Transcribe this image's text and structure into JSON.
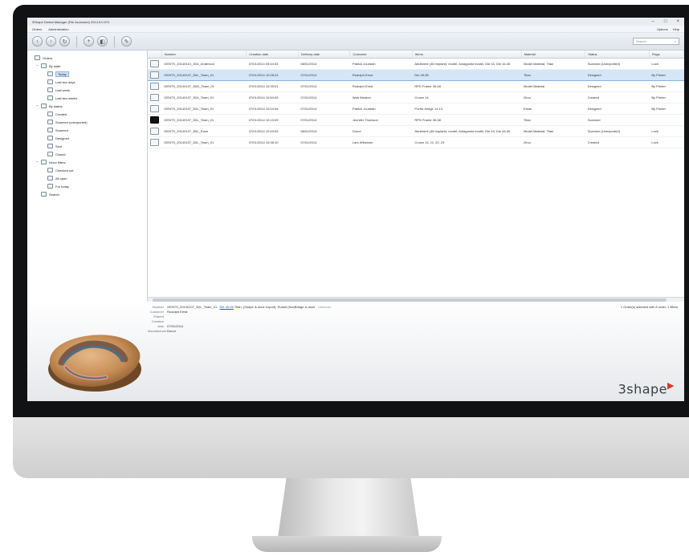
{
  "window": {
    "title": "3Shape Dental Manager (File Accessed) 2014.9.0.574",
    "min": "–",
    "max": "□",
    "close": "×"
  },
  "menu": {
    "items": [
      "Orders",
      "Administration"
    ],
    "right": [
      "Options",
      "Help"
    ]
  },
  "toolbar": {
    "search_placeholder": "Search"
  },
  "sidebar": {
    "items": [
      {
        "label": "Orders",
        "level": 0,
        "expander": ""
      },
      {
        "label": "By state",
        "level": 1,
        "expander": "−"
      },
      {
        "label": "Today",
        "level": 2,
        "expander": "",
        "selected": true
      },
      {
        "label": "Last two days",
        "level": 2,
        "expander": ""
      },
      {
        "label": "Last week",
        "level": 2,
        "expander": ""
      },
      {
        "label": "Last two weeks",
        "level": 2,
        "expander": ""
      },
      {
        "label": "By status",
        "level": 1,
        "expander": "−"
      },
      {
        "label": "Created",
        "level": 2,
        "expander": ""
      },
      {
        "label": "Scanned (unexported)",
        "level": 2,
        "expander": ""
      },
      {
        "label": "Scanned",
        "level": 2,
        "expander": ""
      },
      {
        "label": "Designed",
        "level": 2,
        "expander": ""
      },
      {
        "label": "Sent",
        "level": 2,
        "expander": ""
      },
      {
        "label": "Closed",
        "level": 2,
        "expander": ""
      },
      {
        "label": "Inbox filters",
        "level": 1,
        "expander": "−"
      },
      {
        "label": "Checked out",
        "level": 2,
        "expander": ""
      },
      {
        "label": "All open",
        "level": 2,
        "expander": ""
      },
      {
        "label": "For today",
        "level": 2,
        "expander": ""
      },
      {
        "label": "Search",
        "level": 1,
        "expander": ""
      }
    ]
  },
  "table": {
    "columns": [
      "",
      "Number",
      "Creation date",
      "Delivery date",
      "Customer",
      "Items",
      "Material",
      "Status",
      "Flags"
    ],
    "rows": [
      {
        "icon": "light",
        "number": "GENTS_20140410_3D4_Anderson",
        "created": "07/01/2014 09:44:53",
        "delivery": "08/01/2014",
        "customer": "Patrick Jourdain",
        "items": "Abutment (48 Implant): model, Antagonist model, Die 43, Die 44-45",
        "material": "Model Material; Titan",
        "status": "Scanned (Unexported)",
        "flags": "Lock"
      },
      {
        "icon": "light",
        "number": "GENTS_20140107_3DL_Team_01",
        "created": "07/01/2014 10:28:24",
        "delivery": "07/01/2014",
        "customer": "Rudolph Ernst",
        "items": "Die 45-55",
        "material": "Titan",
        "status": "Designed",
        "flags": "By Printer",
        "selected": true
      },
      {
        "icon": "light",
        "number": "GENTS_20140107_3DD_Team_01",
        "created": "07/01/2014 10:35:01",
        "delivery": "07/01/2014",
        "customer": "Rudolph Ernst",
        "items": "RPD Frame 35-48",
        "material": "Model Material",
        "status": "Designed",
        "flags": "By Printer"
      },
      {
        "icon": "light",
        "number": "GENTS_20140107_3D4_Team_01",
        "created": "07/01/2014 10:54:53",
        "delivery": "07/01/2014",
        "customer": "Walt Wardon",
        "items": "Crown 14",
        "material": "Zirco",
        "status": "Created",
        "flags": "By Printer"
      },
      {
        "icon": "light",
        "number": "GENTS_20140107_3DL_Team_01",
        "created": "07/01/2014 10:04:44",
        "delivery": "07/01/2014",
        "customer": "Patrick Jourdain",
        "items": "Pontic bridge 14-13",
        "material": "Emax",
        "status": "Designed",
        "flags": "By Printer"
      },
      {
        "icon": "dark",
        "number": "GENTS_20140107_3DL_Team_01",
        "created": "07/01/2014 10:13:09",
        "delivery": "07/01/2014",
        "customer": "Jennifer Thomson",
        "items": "RPD Frame 35-38",
        "material": "Titan",
        "status": "Scanned",
        "flags": ""
      },
      {
        "icon": "light",
        "number": "GENTS_20140107_3DL_Rush",
        "created": "07/01/2014 10:49:53",
        "delivery": "08/01/2014",
        "customer": "Donor",
        "items": "Abutment (48 Implant): model, Antagonist model, Die 43, Die 44-45",
        "material": "Model Material; Titan",
        "status": "Scanned (Unexported)",
        "flags": "Lock"
      },
      {
        "icon": "light",
        "number": "GENTS_20140107_3DL_Team_01",
        "created": "07/01/2014 10:38:10",
        "delivery": "07/01/2014",
        "customer": "Lars Wikstrom",
        "items": "Crown 14, 11, 22, 23",
        "material": "Zirco",
        "status": "Created",
        "flags": "Lock"
      }
    ]
  },
  "detail": {
    "fields": [
      {
        "key": "Number",
        "value": "GENTS_20140107_3DL_Team_01",
        "link": "Die 45-55",
        "extra": "Titan, (Shape is done export), Rudolf (NonBridge is done",
        "tail": "Unknown"
      },
      {
        "key": "Customer",
        "value": "Rudolph Ernst"
      },
      {
        "key": "Patient",
        "value": ""
      },
      {
        "key": "Creation date",
        "value": "07/01/2014"
      },
      {
        "key": "Manufacturer",
        "value": "Donor"
      }
    ],
    "right_text": "1 Order(s) selected with 8 order, 1 filters"
  },
  "brand": {
    "logo_text": "3shape",
    "logo_mark": "▶",
    "accent": "#e2332a"
  }
}
